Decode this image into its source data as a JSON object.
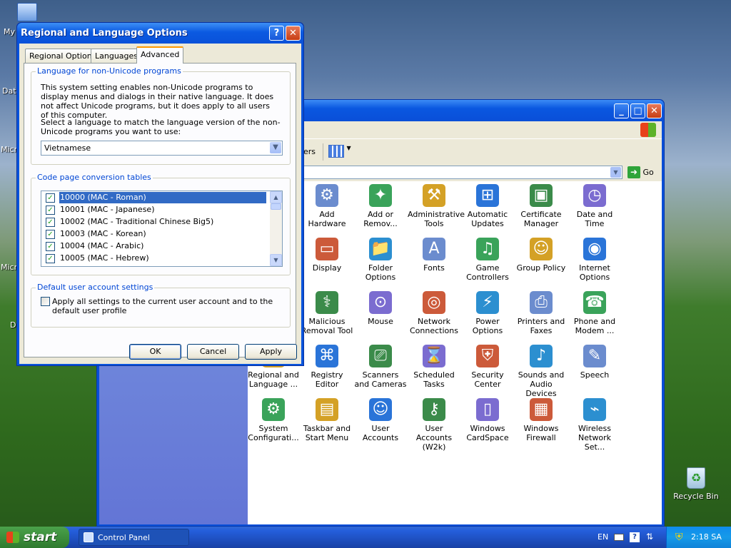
{
  "desktop": {
    "icons": [
      "My",
      "Dat",
      "Micro",
      "Micro",
      "D"
    ],
    "recycle_bin_label": "Recycle Bin"
  },
  "control_panel": {
    "toolbar_partial_text": "ers",
    "go_label": "Go",
    "items": [
      {
        "label": "Add Hardware",
        "icon": "add-hardware-icon"
      },
      {
        "label": "Add or Remov...",
        "icon": "add-remove-programs-icon"
      },
      {
        "label": "Administrative Tools",
        "icon": "administrative-tools-icon"
      },
      {
        "label": "Automatic Updates",
        "icon": "automatic-updates-icon"
      },
      {
        "label": "Certificate Manager",
        "icon": "certificate-manager-icon"
      },
      {
        "label": "Date and Time",
        "icon": "date-time-icon"
      },
      {
        "label": "Display",
        "icon": "display-icon"
      },
      {
        "label": "Folder Options",
        "icon": "folder-options-icon"
      },
      {
        "label": "Fonts",
        "icon": "fonts-icon"
      },
      {
        "label": "Game Controllers",
        "icon": "game-controllers-icon"
      },
      {
        "label": "Group Policy",
        "icon": "group-policy-icon"
      },
      {
        "label": "Internet Options",
        "icon": "internet-options-icon"
      },
      {
        "label": "Malicious Removal Tool",
        "icon": "malicious-removal-tool-icon"
      },
      {
        "label": "Mouse",
        "icon": "mouse-icon"
      },
      {
        "label": "Network Connections",
        "icon": "network-connections-icon"
      },
      {
        "label": "Power Options",
        "icon": "power-options-icon"
      },
      {
        "label": "Printers and Faxes",
        "icon": "printers-faxes-icon"
      },
      {
        "label": "Phone and Modem ...",
        "icon": "phone-modem-icon"
      },
      {
        "label": "Regional and Language ...",
        "icon": "regional-language-icon"
      },
      {
        "label": "Registry Editor",
        "icon": "registry-editor-icon"
      },
      {
        "label": "Scanners and Cameras",
        "icon": "scanners-cameras-icon"
      },
      {
        "label": "Scheduled Tasks",
        "icon": "scheduled-tasks-icon"
      },
      {
        "label": "Security Center",
        "icon": "security-center-icon"
      },
      {
        "label": "Sounds and Audio Devices",
        "icon": "sounds-audio-icon"
      },
      {
        "label": "Speech",
        "icon": "speech-icon"
      },
      {
        "label": "System Configurati...",
        "icon": "system-configuration-icon"
      },
      {
        "label": "Taskbar and Start Menu",
        "icon": "taskbar-start-menu-icon"
      },
      {
        "label": "User Accounts",
        "icon": "user-accounts-icon"
      },
      {
        "label": "User Accounts (W2k)",
        "icon": "user-accounts-w2k-icon"
      },
      {
        "label": "Windows CardSpace",
        "icon": "windows-cardspace-icon"
      },
      {
        "label": "Windows Firewall",
        "icon": "windows-firewall-icon"
      },
      {
        "label": "Wireless Network Set...",
        "icon": "wireless-network-icon"
      }
    ]
  },
  "dialog": {
    "title": "Regional and Language Options",
    "help_glyph": "?",
    "close_glyph": "✕",
    "tabs": [
      "Regional Options",
      "Languages",
      "Advanced"
    ],
    "active_tab": "Advanced",
    "non_unicode": {
      "group_label": "Language for non-Unicode programs",
      "desc1": "This system setting enables non-Unicode programs to display menus and dialogs in their native language. It does not affect Unicode programs, but it does apply to all users of this computer.",
      "desc2": "Select a language to match the language version of the non-Unicode programs you want to use:",
      "selected_language": "Vietnamese"
    },
    "code_pages": {
      "group_label": "Code page conversion tables",
      "items": [
        {
          "label": "10000 (MAC - Roman)",
          "checked": true
        },
        {
          "label": "10001 (MAC - Japanese)",
          "checked": true
        },
        {
          "label": "10002 (MAC - Traditional Chinese Big5)",
          "checked": true
        },
        {
          "label": "10003 (MAC - Korean)",
          "checked": true
        },
        {
          "label": "10004 (MAC - Arabic)",
          "checked": true
        },
        {
          "label": "10005 (MAC - Hebrew)",
          "checked": true
        }
      ]
    },
    "default_user": {
      "group_label": "Default user account settings",
      "checkbox_label": "Apply all settings to the current user account and to the default user profile"
    },
    "buttons": {
      "ok": "OK",
      "cancel": "Cancel",
      "apply": "Apply"
    }
  },
  "taskbar": {
    "start_label": "start",
    "task_label": "Control Panel",
    "language": "EN",
    "clock": "2:18 SA"
  },
  "colors": {
    "xp_blue": "#0a54dc",
    "dialog_face": "#ece9d8",
    "selection": "#316ac5",
    "group_label": "#0046d5",
    "start_green": "#3c8e3c"
  }
}
